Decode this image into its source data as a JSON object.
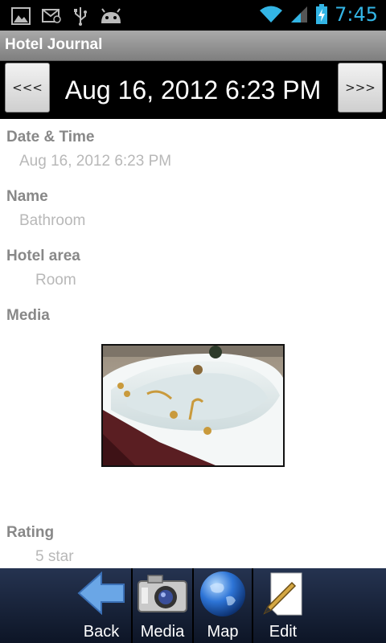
{
  "status_bar": {
    "time": "7:45"
  },
  "app": {
    "title": "Hotel Journal"
  },
  "date_nav": {
    "prev_label": "<<<",
    "date": "Aug 16, 2012 6:23 PM",
    "next_label": ">>>"
  },
  "fields": {
    "datetime": {
      "label": "Date & Time",
      "value": "Aug 16, 2012 6:23 PM"
    },
    "name": {
      "label": "Name",
      "value": "Bathroom"
    },
    "area": {
      "label": "Hotel area",
      "value": "Room"
    },
    "media": {
      "label": "Media"
    },
    "rating": {
      "label": "Rating",
      "value": "5 star"
    }
  },
  "toolbar": {
    "back": "Back",
    "media": "Media",
    "map": "Map",
    "edit": "Edit"
  },
  "colors": {
    "accent": "#33b5e5",
    "toolbar_top": "#253350",
    "toolbar_bottom": "#0d1526"
  }
}
